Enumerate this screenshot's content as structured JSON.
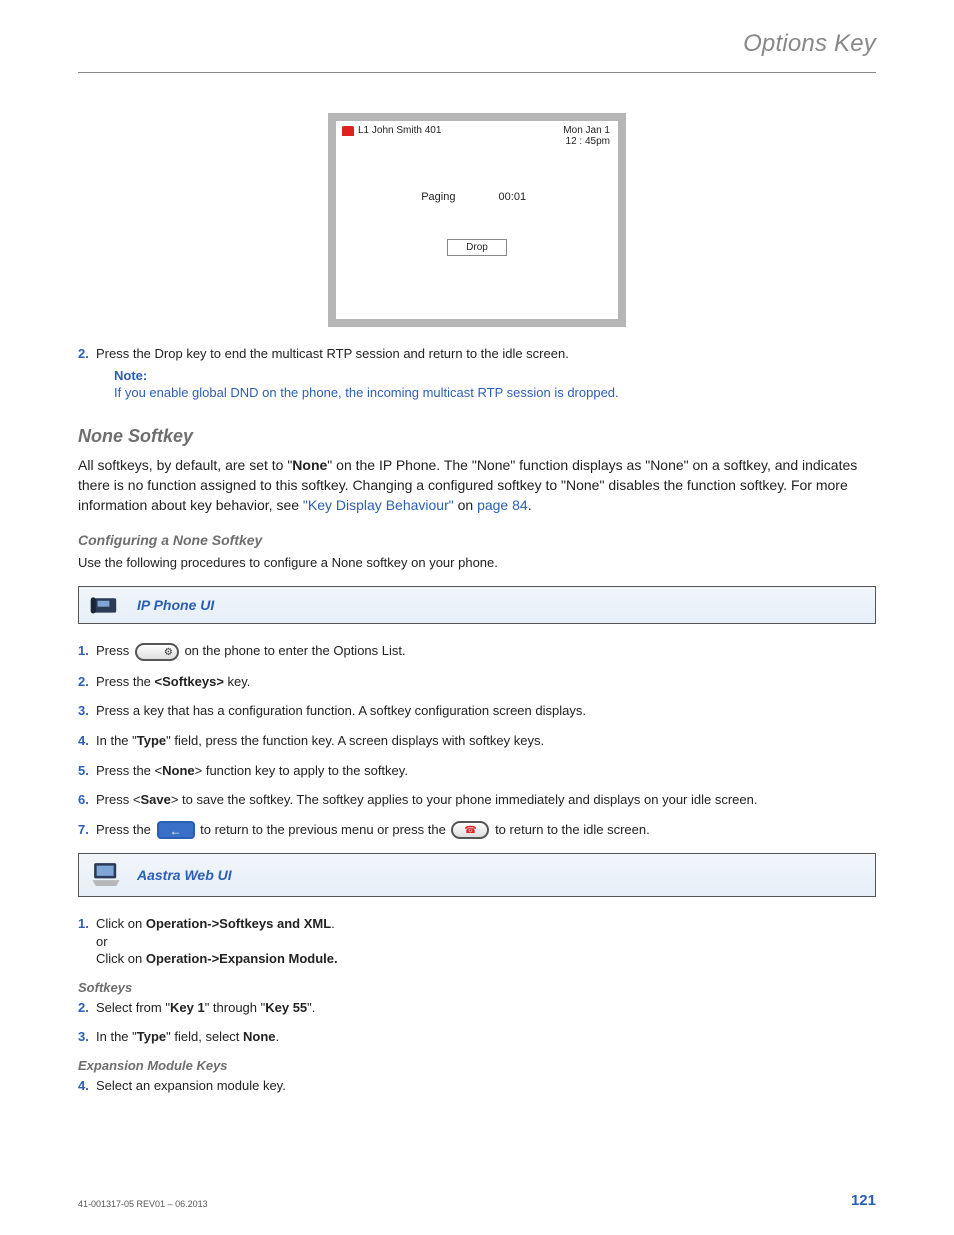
{
  "header": {
    "title": "Options Key"
  },
  "phone_screen": {
    "line": "L1 John Smith 401",
    "date": "Mon Jan 1",
    "time": "12 : 45pm",
    "status": "Paging",
    "timer": "00:01",
    "drop": "Drop"
  },
  "step2": {
    "num": "2.",
    "text": "Press the Drop key to end the multicast RTP session and return to the idle screen.",
    "note_label": "Note:",
    "note_text": "If you enable global DND on the phone, the incoming multicast RTP session is dropped."
  },
  "none_softkey": {
    "heading": "None Softkey",
    "para_a": "All softkeys, by default, are set to \"",
    "para_b": "None",
    "para_c": "\" on the IP Phone. The \"None\" function displays as \"None\" on a softkey, and indicates there is no function assigned to this softkey. Changing a configured softkey to \"None\" disables the function softkey. For more information about key behavior, see ",
    "link1": "\"Key Display Behaviour\"",
    "mid": " on ",
    "link2": "page 84",
    "end": "."
  },
  "config": {
    "heading": "Configuring a None Softkey",
    "intro": "Use the following procedures to configure a None softkey on your phone."
  },
  "ip_box": {
    "label": "IP Phone UI"
  },
  "ip_steps": {
    "s1": {
      "num": "1.",
      "a": "Press ",
      "b": " on the phone to enter the Options List."
    },
    "s2": {
      "num": "2.",
      "a": "Press the ",
      "b": "<Softkeys>",
      "c": " key."
    },
    "s3": {
      "num": "3.",
      "t": "Press a key that has a configuration function. A softkey configuration screen displays."
    },
    "s4": {
      "num": "4.",
      "a": "In the \"",
      "b": "Type",
      "c": "\" field, press the function key. A screen displays with softkey keys."
    },
    "s5": {
      "num": "5.",
      "a": "Press the <",
      "b": "None",
      "c": "> function key to apply to the softkey."
    },
    "s6": {
      "num": "6.",
      "a": "Press <",
      "b": "Save",
      "c": "> to save the softkey. The softkey applies to your phone immediately and displays on your idle screen."
    },
    "s7": {
      "num": "7.",
      "a": "Press the ",
      "b": " to return to the previous menu or press the ",
      "c": " to return to the idle screen."
    }
  },
  "web_box": {
    "label": "Aastra Web UI"
  },
  "web_steps": {
    "s1": {
      "num": "1.",
      "a": "Click on ",
      "b": "Operation->Softkeys and XML",
      "c": ".",
      "or": "or",
      "d": "Click on ",
      "e": "Operation->Expansion Module."
    },
    "softkeys_h": "Softkeys",
    "s2": {
      "num": "2.",
      "a": "Select from \"",
      "b": "Key 1",
      "c": "\" through \"",
      "d": "Key 55",
      "e": "\"."
    },
    "s3": {
      "num": "3.",
      "a": "In the \"",
      "b": "Type",
      "c": "\" field, select ",
      "d": "None",
      "e": "."
    },
    "exp_h": "Expansion Module Keys",
    "s4": {
      "num": "4.",
      "t": "Select an expansion module key."
    }
  },
  "footer": {
    "left": "41-001317-05 REV01 – 06.2013",
    "right": "121"
  }
}
